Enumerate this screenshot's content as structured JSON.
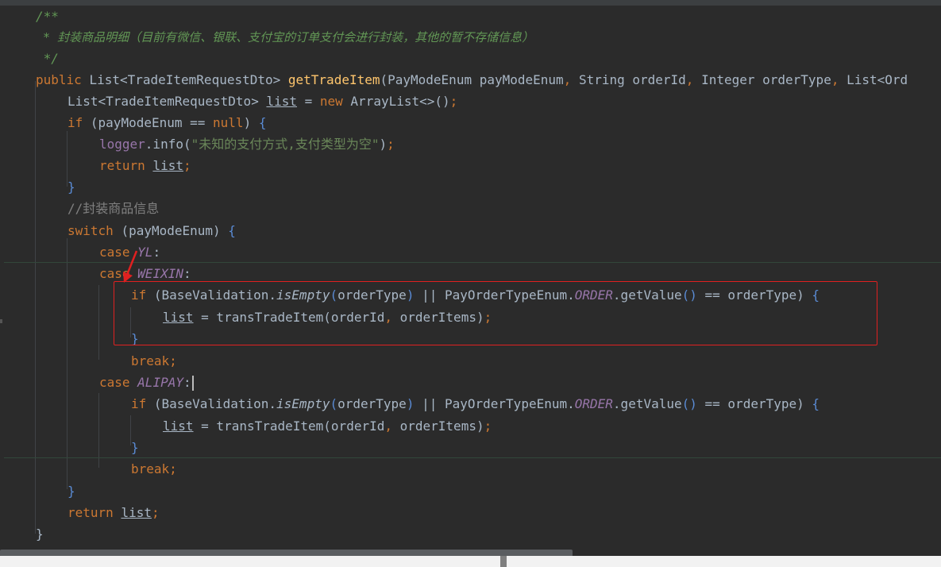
{
  "editor": {
    "language": "java",
    "lines": [
      "/**",
      " * 封装商品明细（目前有微信、银联、支付宝的订单支付会进行封装，其他的暂不存储信息）",
      " */",
      "public List<TradeItemRequestDto> getTradeItem(PayModeEnum payModeEnum, String orderId, Integer orderType, List<Ord",
      "List<TradeItemRequestDto> list = new ArrayList<>();",
      "if (payModeEnum == null) {",
      "logger.info(\"未知的支付方式,支付类型为空\");",
      "return list;",
      "}",
      "//封装商品信息",
      "switch (payModeEnum) {",
      "case YL:",
      "case WEIXIN:",
      "if (BaseValidation.isEmpty(orderType) || PayOrderTypeEnum.ORDER.getValue() == orderType) {",
      "list = transTradeItem(orderId, orderItems);",
      "}",
      "break;",
      "case ALIPAY:",
      "if (BaseValidation.isEmpty(orderType) || PayOrderTypeEnum.ORDER.getValue() == orderType) {",
      "list = transTradeItem(orderId, orderItems);",
      "}",
      "break;",
      "}",
      "return list;",
      "}"
    ]
  },
  "colors": {
    "background": "#2b2b2b",
    "keyword": "#cc7832",
    "method": "#ffc66d",
    "doc_comment": "#629755",
    "string": "#6a8759",
    "constant": "#9876aa",
    "text": "#a9b7c6",
    "annotation_box": "#e02020"
  }
}
